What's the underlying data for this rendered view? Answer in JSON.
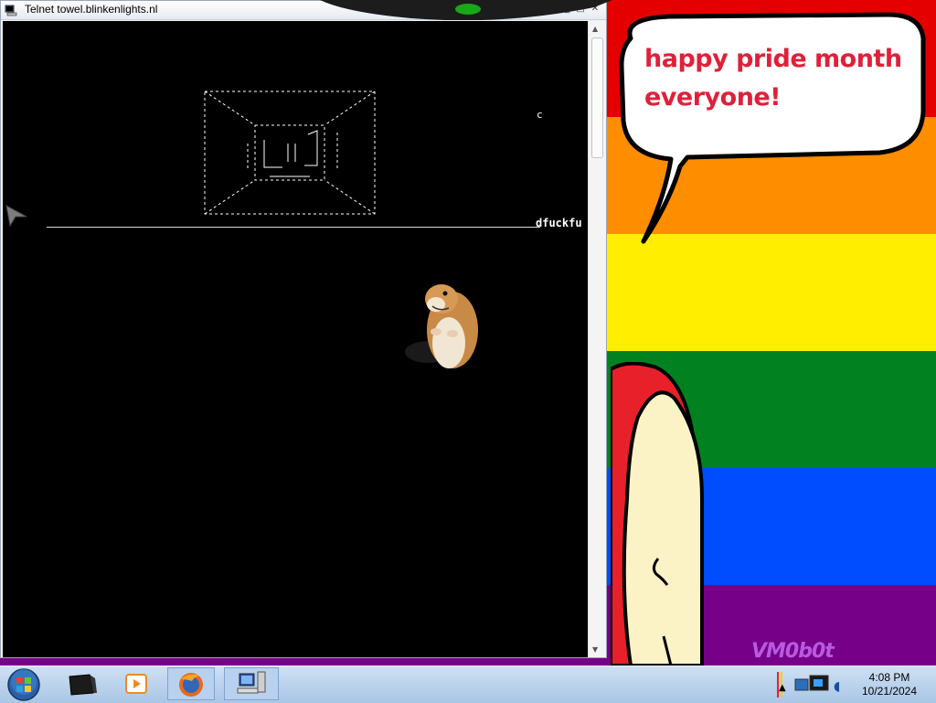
{
  "window": {
    "title": "Telnet towel.blinkenlights.nl"
  },
  "console": {
    "stray_char": "c",
    "scrolled_text": "dfuckfu"
  },
  "wallpaper": {
    "speech_text": "happy pride month everyone!",
    "watermark": "VM0b0t",
    "stripe_colors": [
      "#e50000",
      "#ff8d00",
      "#ffee00",
      "#028121",
      "#004cff",
      "#770088"
    ]
  },
  "taskbar": {
    "time": "4:08 PM",
    "date": "10/21/2024",
    "apps": [
      "start-orb",
      "terminal",
      "media-player",
      "firefox",
      "network-computer"
    ]
  }
}
